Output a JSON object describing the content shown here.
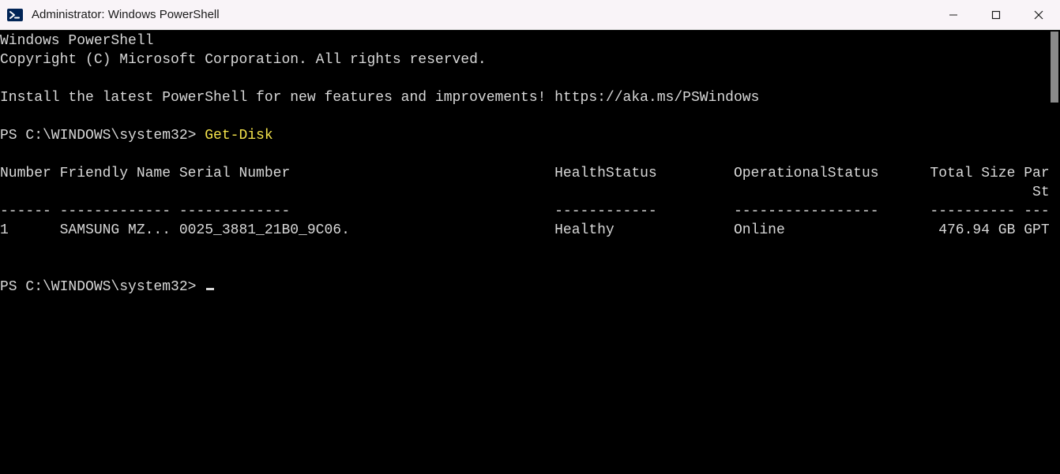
{
  "titlebar": {
    "title": "Administrator: Windows PowerShell"
  },
  "terminal": {
    "banner_line1": "Windows PowerShell",
    "banner_line2": "Copyright (C) Microsoft Corporation. All rights reserved.",
    "install_msg": "Install the latest PowerShell for new features and improvements! https://aka.ms/PSWindows",
    "prompt1_prefix": "PS C:\\WINDOWS\\system32> ",
    "prompt1_command": "Get-Disk",
    "table": {
      "headers_line1": "Number Friendly Name Serial Number                               HealthStatus         OperationalStatus      Total Size Partition",
      "headers_line2": "                                                                                                                         Style",
      "divider": "------ ------------- -------------                               ------------         -----------------      ---------- ----------",
      "row1": "1      SAMSUNG MZ... 0025_3881_21B0_9C06.                        Healthy              Online                  476.94 GB GPT"
    },
    "prompt2_prefix": "PS C:\\WINDOWS\\system32> "
  }
}
